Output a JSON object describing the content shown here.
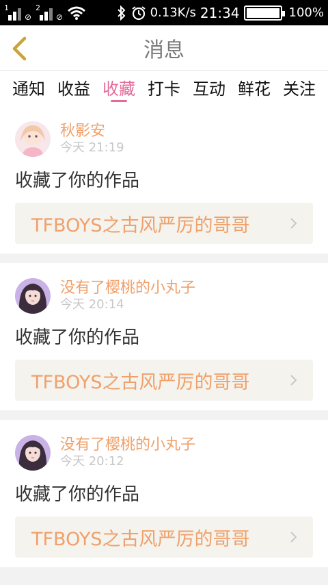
{
  "status_bar": {
    "sim1": "1",
    "sim2": "2",
    "speed": "0.13K/s",
    "time": "21:34",
    "battery": "100%",
    "battery_level": 1.0
  },
  "header": {
    "title": "消息"
  },
  "tabs": [
    {
      "label": "通知"
    },
    {
      "label": "收益"
    },
    {
      "label": "收藏"
    },
    {
      "label": "打卡"
    },
    {
      "label": "互动"
    },
    {
      "label": "鲜花"
    },
    {
      "label": "关注"
    }
  ],
  "active_tab": "收藏",
  "accent_color": "#e56a9a",
  "username_color": "#f0a06a",
  "items": [
    {
      "username": "秋影安",
      "time": "今天 21:19",
      "action": "收藏了你的作品",
      "work_title": "TFBOYS之古风严厉的哥哥"
    },
    {
      "username": "没有了樱桃的小丸子",
      "time": "今天 20:14",
      "action": "收藏了你的作品",
      "work_title": "TFBOYS之古风严厉的哥哥"
    },
    {
      "username": "没有了樱桃的小丸子",
      "time": "今天 20:12",
      "action": "收藏了你的作品",
      "work_title": "TFBOYS之古风严厉的哥哥"
    }
  ]
}
